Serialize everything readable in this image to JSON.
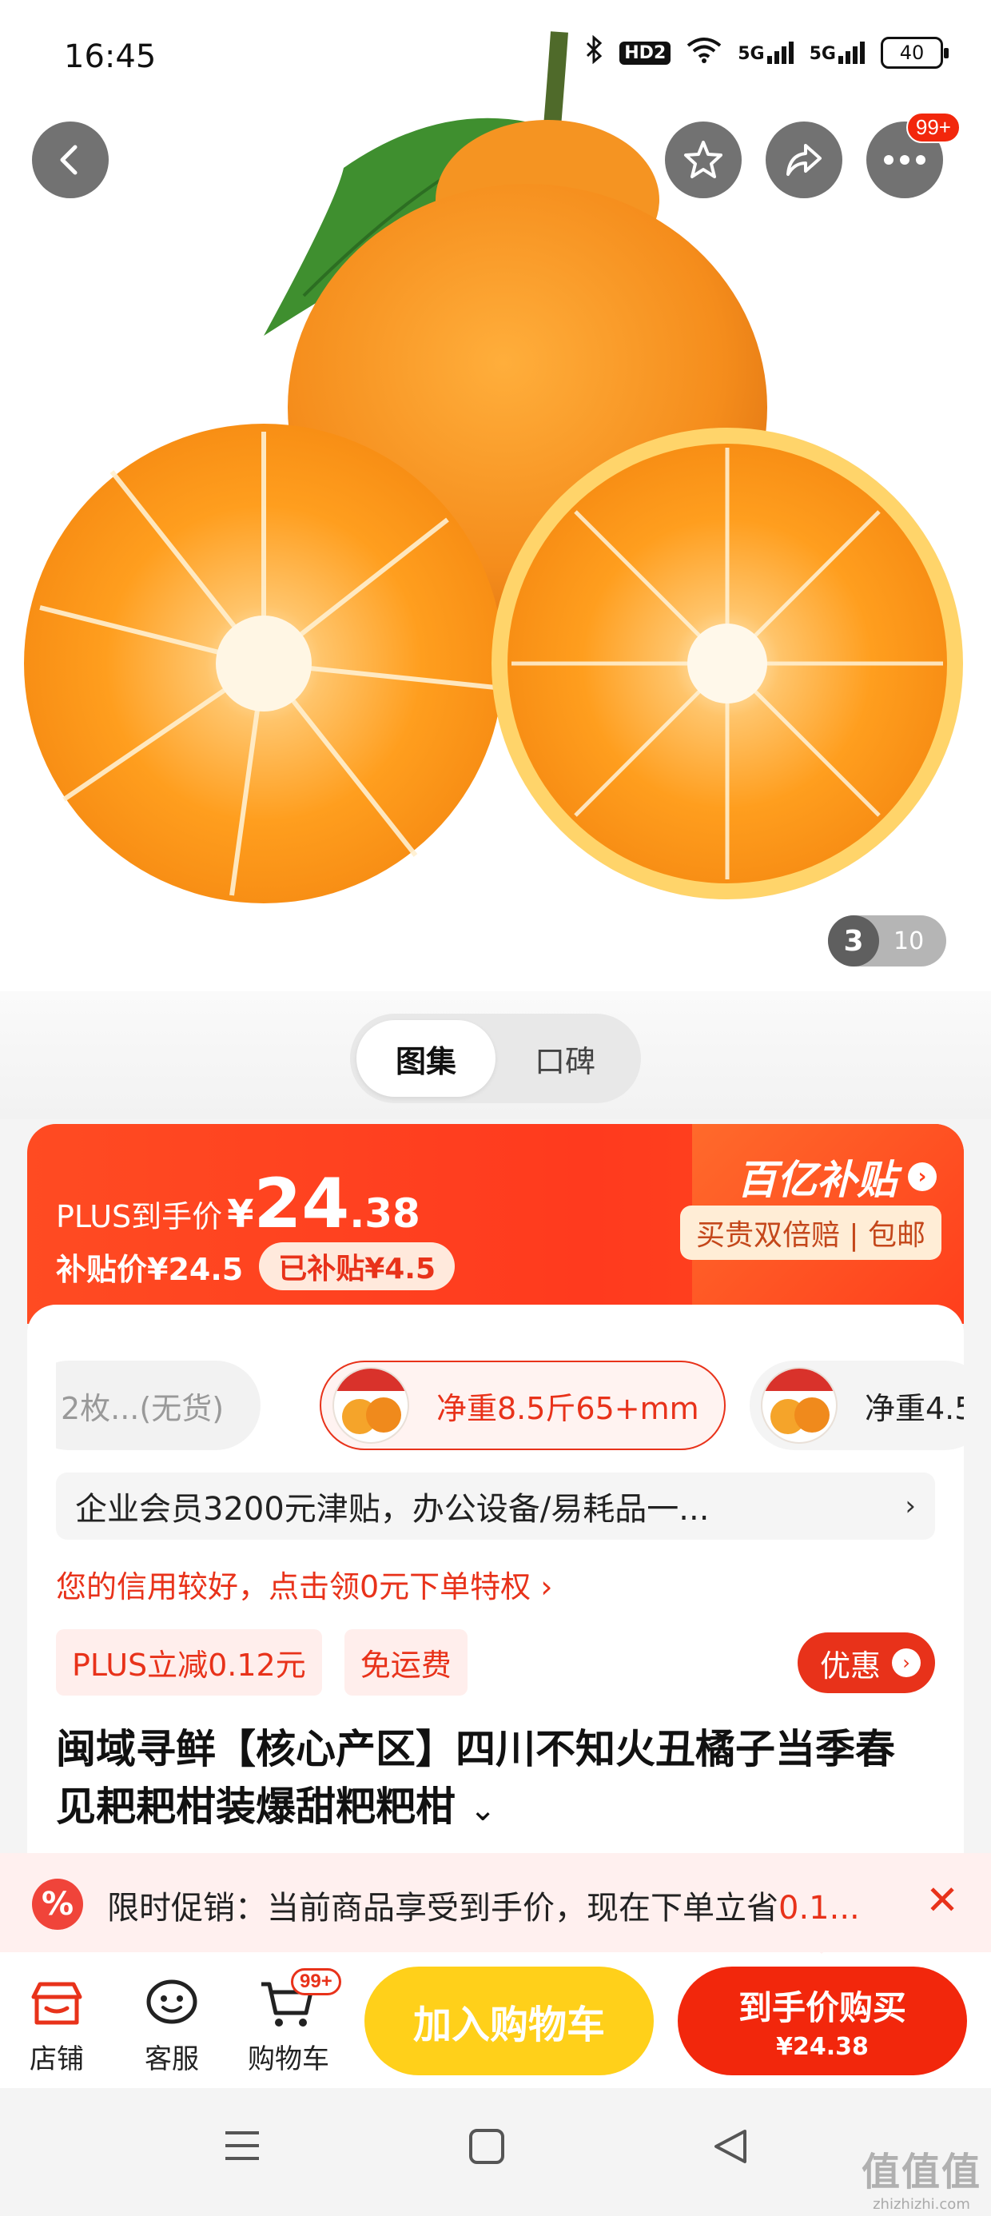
{
  "status_bar": {
    "time": "16:45",
    "hd": "HD2",
    "net1": "5G",
    "net2": "5G",
    "battery": "40"
  },
  "top_actions": {
    "badge": "99+"
  },
  "gallery": {
    "current": "3",
    "total": "10"
  },
  "tabs": [
    "图集",
    "口碑"
  ],
  "price": {
    "plus_label": "PLUS到手价",
    "currency": "¥",
    "integer": "24",
    "decimal": ".38",
    "subsidy_text": "补贴价¥24.5",
    "subsidized_pill": "已补贴¥4.5",
    "program_logo": "百亿补贴",
    "program_tag": "买贵双倍赔 | 包邮"
  },
  "skus": [
    {
      "label": "2枚...(无货)",
      "state": "unavailable"
    },
    {
      "label": "净重8.5斤65+mm",
      "state": "selected"
    },
    {
      "label": "净重4.5",
      "state": "normal"
    }
  ],
  "enterprise_banner": "企业会员3200元津贴，办公设备/易耗品一...",
  "credit_text": "您的信用较好，点击领0元下单特权 ›",
  "tags": [
    "PLUS立减0.12元",
    "免运费"
  ],
  "discount_button": "优惠",
  "product_title": "闽域寻鲜【核心产区】四川不知火丑橘子当季春见耙耙柑装爆甜粑粑柑",
  "promo": {
    "prefix": "限时促销：当前商品享受到手价，现在下单立省",
    "amount": "0.1..."
  },
  "bottom_nav": [
    {
      "label": "店铺",
      "icon": "store-icon"
    },
    {
      "label": "客服",
      "icon": "chat-smile-icon"
    },
    {
      "label": "购物车",
      "icon": "cart-icon",
      "badge": "99+"
    }
  ],
  "buttons": {
    "add_to_cart": "加入购物车",
    "buy_now": "到手价购买",
    "buy_now_price": "¥24.38"
  },
  "colors": {
    "brand_red": "#f2270c",
    "cart_yellow": "#ffd01a",
    "price_banner": "#ff3e1c"
  },
  "watermark": {
    "big": "值值值",
    "small": "zhizhizhi.com"
  }
}
